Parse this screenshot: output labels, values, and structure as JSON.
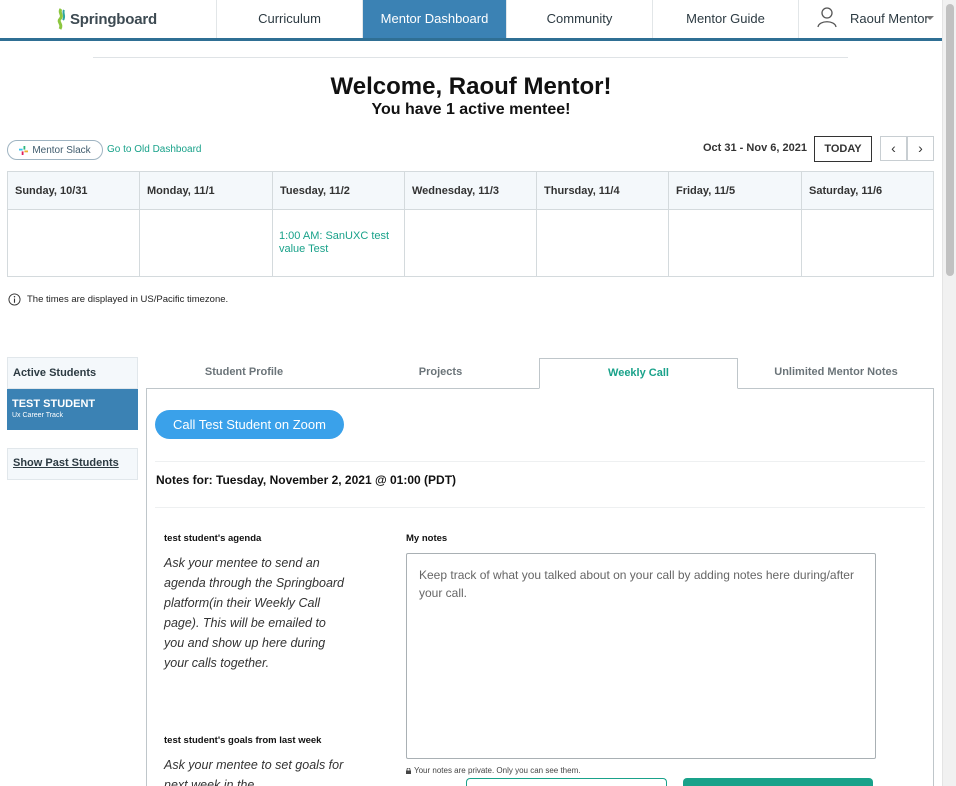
{
  "brand": {
    "name": "Springboard"
  },
  "nav": {
    "tabs": [
      {
        "label": "Curriculum"
      },
      {
        "label": "Mentor Dashboard"
      },
      {
        "label": "Community"
      },
      {
        "label": "Mentor Guide"
      }
    ],
    "user_name": "Raouf Mentor"
  },
  "welcome": {
    "title": "Welcome, Raouf Mentor!",
    "subtitle": "You have 1 active mentee!"
  },
  "links": {
    "mentor_slack": "Mentor Slack",
    "old_dashboard": "Go to Old Dashboard"
  },
  "calendar": {
    "range": "Oct 31 - Nov 6, 2021",
    "today_label": "TODAY",
    "prev_icon": "‹",
    "next_icon": "›",
    "days": [
      {
        "header": "Sunday, 10/31",
        "event": ""
      },
      {
        "header": "Monday, 11/1",
        "event": ""
      },
      {
        "header": "Tuesday, 11/2",
        "event": "1:00 AM: SanUXC test value Test"
      },
      {
        "header": "Wednesday, 11/3",
        "event": ""
      },
      {
        "header": "Thursday, 11/4",
        "event": ""
      },
      {
        "header": "Friday, 11/5",
        "event": ""
      },
      {
        "header": "Saturday, 11/6",
        "event": ""
      }
    ],
    "timezone_note": "The times are displayed in US/Pacific timezone."
  },
  "students": {
    "active_header": "Active Students",
    "selected": {
      "name": "TEST STUDENT",
      "track": "Ux Career Track"
    },
    "show_past": "Show Past Students"
  },
  "tabs": [
    {
      "label": "Student Profile"
    },
    {
      "label": "Projects"
    },
    {
      "label": "Weekly Call"
    },
    {
      "label": "Unlimited Mentor Notes"
    }
  ],
  "weekly_call": {
    "zoom_button": "Call Test Student on Zoom",
    "notes_for": "Notes for: Tuesday, November 2, 2021 @ 01:00 (PDT)",
    "agenda_heading": "test student's agenda",
    "agenda_text": "Ask your mentee to send an agenda through the Springboard platform(in their Weekly Call page). This will be emailed to you and show up here during your calls together.",
    "goals_heading": "test student's goals from last week",
    "goals_text": "Ask your mentee to set goals for next week in the",
    "my_notes_heading": "My notes",
    "my_notes_placeholder": "Keep track of what you talked about on your call by adding notes here during/after your call.",
    "private_note": "Your notes are private. Only you can see them."
  },
  "colors": {
    "accent_blue": "#3b82b4",
    "zoom_blue": "#3aa1ea",
    "teal": "#19a28a"
  }
}
